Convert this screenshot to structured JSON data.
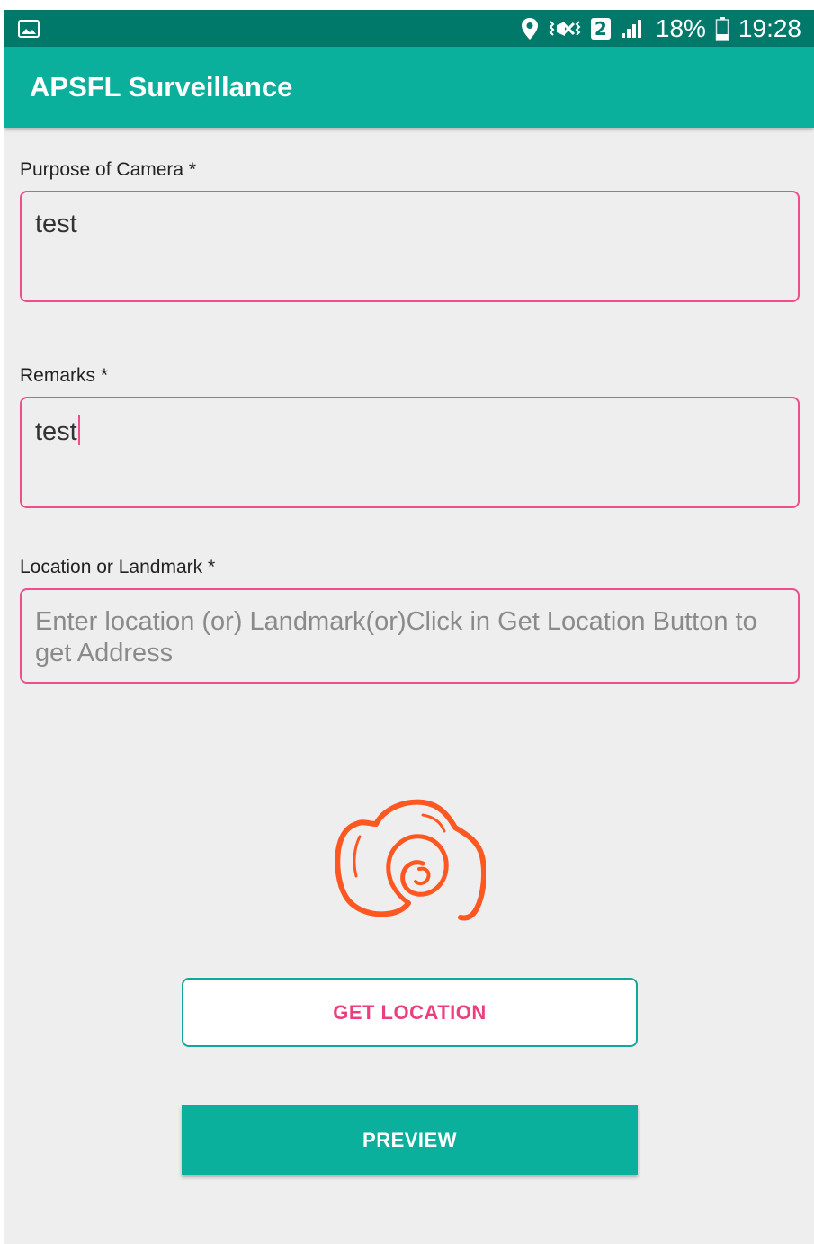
{
  "status_bar": {
    "battery": "18%",
    "time": "19:28",
    "sim_slot": "2",
    "icons": [
      "gallery-icon",
      "location-pin-icon",
      "vibrate-icon",
      "sim-2-icon",
      "signal-icon",
      "battery-icon"
    ]
  },
  "app_bar": {
    "title": "APSFL Surveillance",
    "color": "#0bb09c"
  },
  "form": {
    "purpose": {
      "label": "Purpose of Camera *",
      "value": "test"
    },
    "remarks": {
      "label": "Remarks *",
      "value": "test"
    },
    "location": {
      "label": "Location or Landmark *",
      "value": "",
      "placeholder": "Enter location (or) Landmark(or)Click in Get Location Button to get Address"
    }
  },
  "camera_icon": "camera-icon",
  "buttons": {
    "get_location": "GET LOCATION",
    "preview": "PREVIEW"
  },
  "colors": {
    "accent_pink": "#ec4f8a",
    "teal": "#0bb09c",
    "status_bar": "#00796b",
    "camera_orange": "#ff5722"
  }
}
